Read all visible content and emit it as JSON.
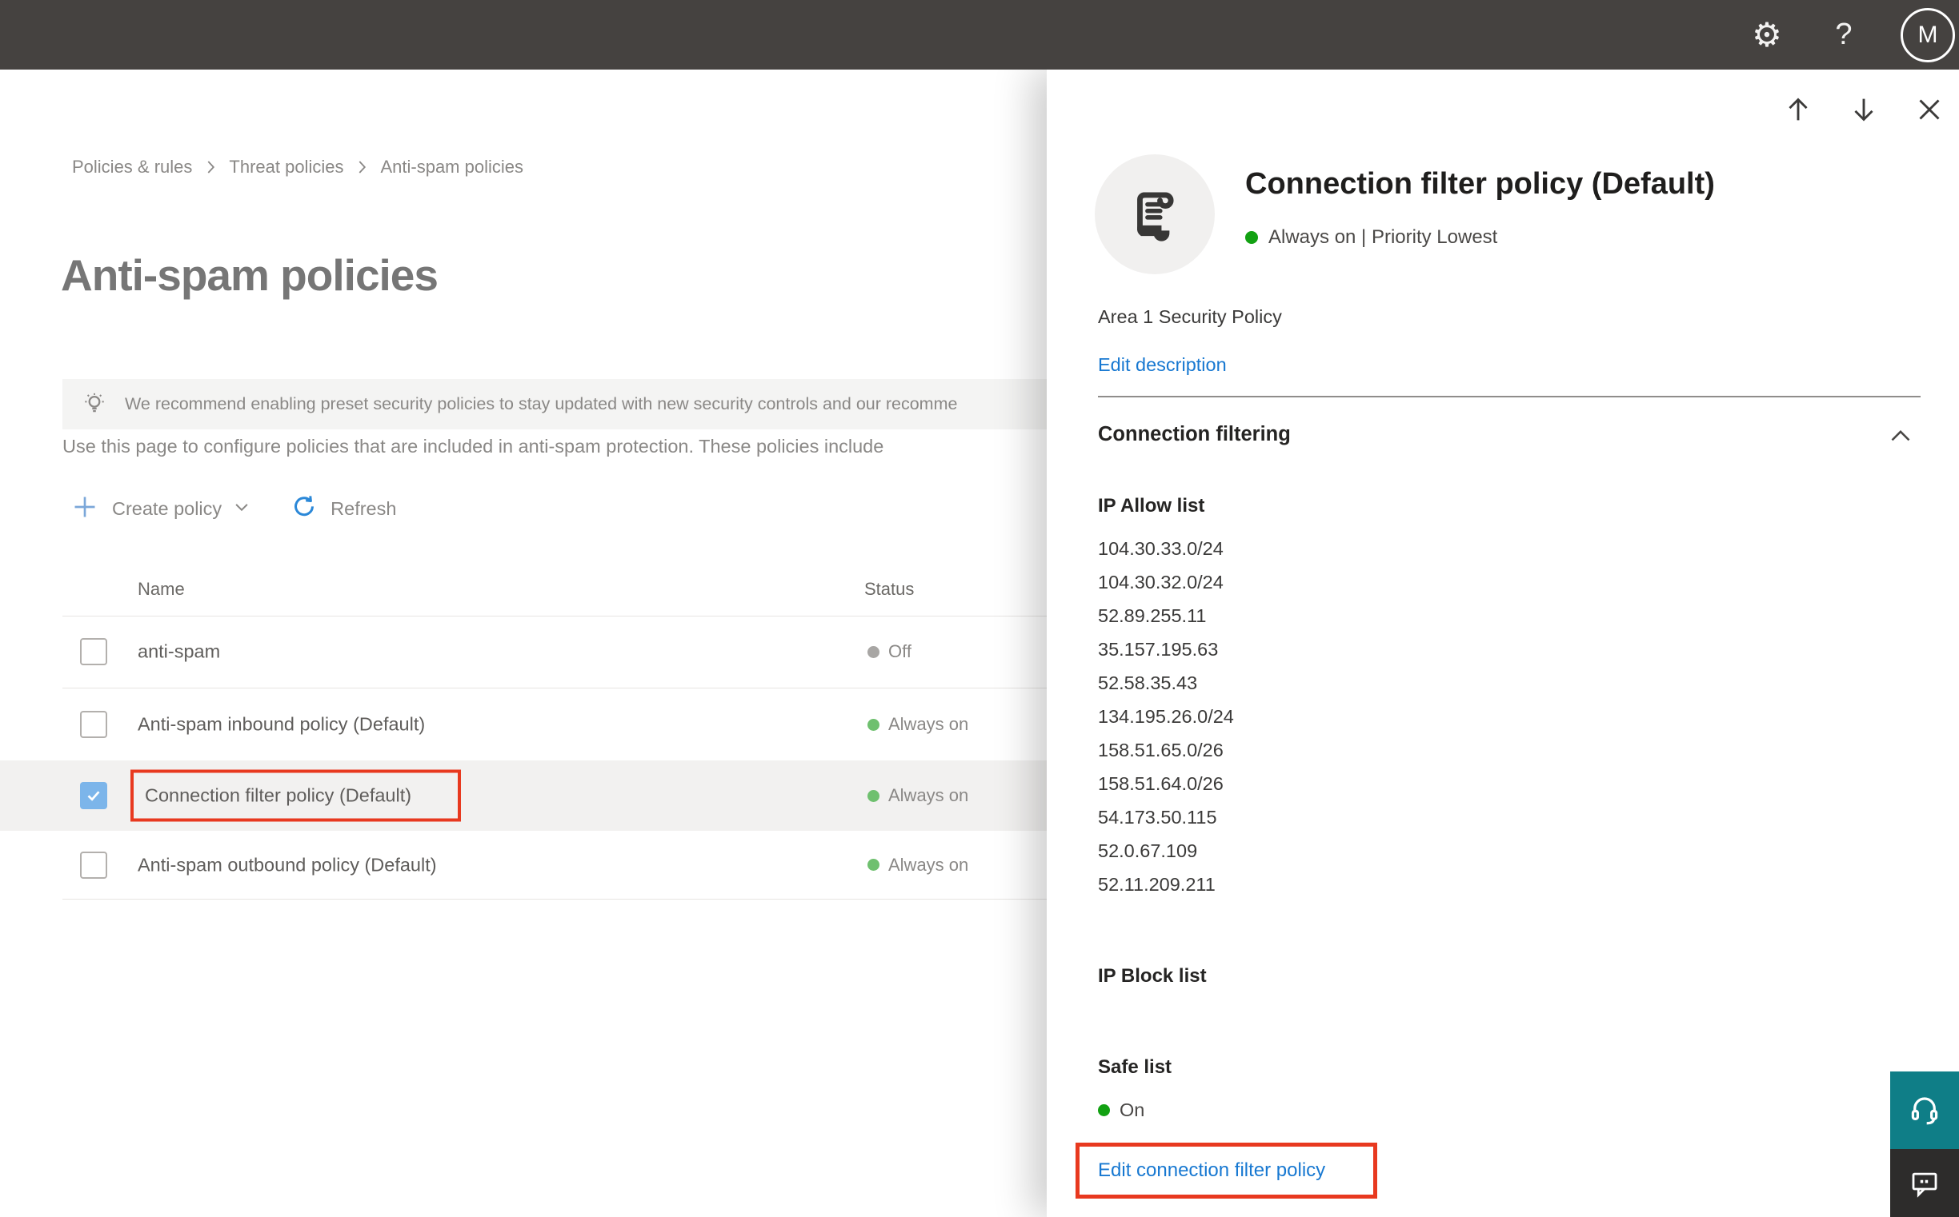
{
  "topbar": {
    "avatar_initial": "M"
  },
  "breadcrumb": {
    "items": [
      "Policies & rules",
      "Threat policies",
      "Anti-spam policies"
    ]
  },
  "page": {
    "title": "Anti-spam policies",
    "banner_text": "We recommend enabling preset security policies to stay updated with new security controls and our recomme",
    "description": "Use this page to configure policies that are included in anti-spam protection. These policies include",
    "create_policy_label": "Create policy",
    "refresh_label": "Refresh"
  },
  "table": {
    "columns": [
      "Name",
      "Status"
    ],
    "rows": [
      {
        "name": "anti-spam",
        "status": "Off",
        "status_color": "#a8a6a4",
        "checked": false,
        "selected": false
      },
      {
        "name": "Anti-spam inbound policy (Default)",
        "status": "Always on",
        "status_color": "#6fc06f",
        "checked": false,
        "selected": false
      },
      {
        "name": "Connection filter policy (Default)",
        "status": "Always on",
        "status_color": "#6fc06f",
        "checked": true,
        "selected": true,
        "highlighted": true
      },
      {
        "name": "Anti-spam outbound policy (Default)",
        "status": "Always on",
        "status_color": "#6fc06f",
        "checked": false,
        "selected": false
      }
    ]
  },
  "flyout": {
    "title": "Connection filter policy (Default)",
    "status_line": "Always on | Priority Lowest",
    "status_color": "#12a112",
    "description": "Area 1 Security Policy",
    "edit_description_label": "Edit description",
    "section_title": "Connection filtering",
    "ip_allow": {
      "title": "IP Allow list",
      "ips": [
        "104.30.33.0/24",
        "104.30.32.0/24",
        "52.89.255.11",
        "35.157.195.63",
        "52.58.35.43",
        "134.195.26.0/24",
        "158.51.65.0/26",
        "158.51.64.0/26",
        "54.173.50.115",
        "52.0.67.109",
        "52.11.209.211"
      ]
    },
    "ip_block": {
      "title": "IP Block list"
    },
    "safe_list": {
      "title": "Safe list",
      "status": "On"
    },
    "edit_link_label": "Edit connection filter policy"
  },
  "colors": {
    "topbar_bg": "#454240",
    "accent_blue": "#1778d1",
    "highlight_red": "#e8391f",
    "support_teal": "#0f7e87",
    "on_green_bright": "#12a112",
    "on_green_soft": "#6fc06f",
    "off_gray": "#a8a6a4",
    "checkbox_blue": "#7cb5ea",
    "selected_row_bg": "#f2f1f0"
  }
}
